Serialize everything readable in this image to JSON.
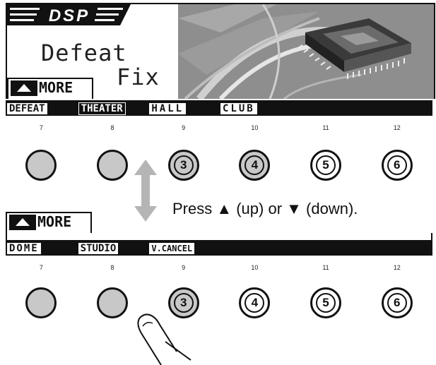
{
  "screen1": {
    "badge": "DSP",
    "mode_line1": "Defeat",
    "mode_line2": "Fix",
    "more_label": "MORE",
    "function_keys": [
      "DEFEAT",
      "THEATER",
      "HALL",
      "CLUB",
      "",
      ""
    ]
  },
  "screen2": {
    "more_label": "MORE",
    "function_keys": [
      "DOME",
      "STUDIO",
      "V.CANCEL",
      "",
      "",
      ""
    ]
  },
  "key_numbers": [
    "7",
    "8",
    "9",
    "10",
    "11",
    "12"
  ],
  "preset_buttons": [
    "",
    "",
    "3",
    "4",
    "5",
    "6"
  ],
  "instruction": "Press ▲ (up) or ▼ (down)."
}
